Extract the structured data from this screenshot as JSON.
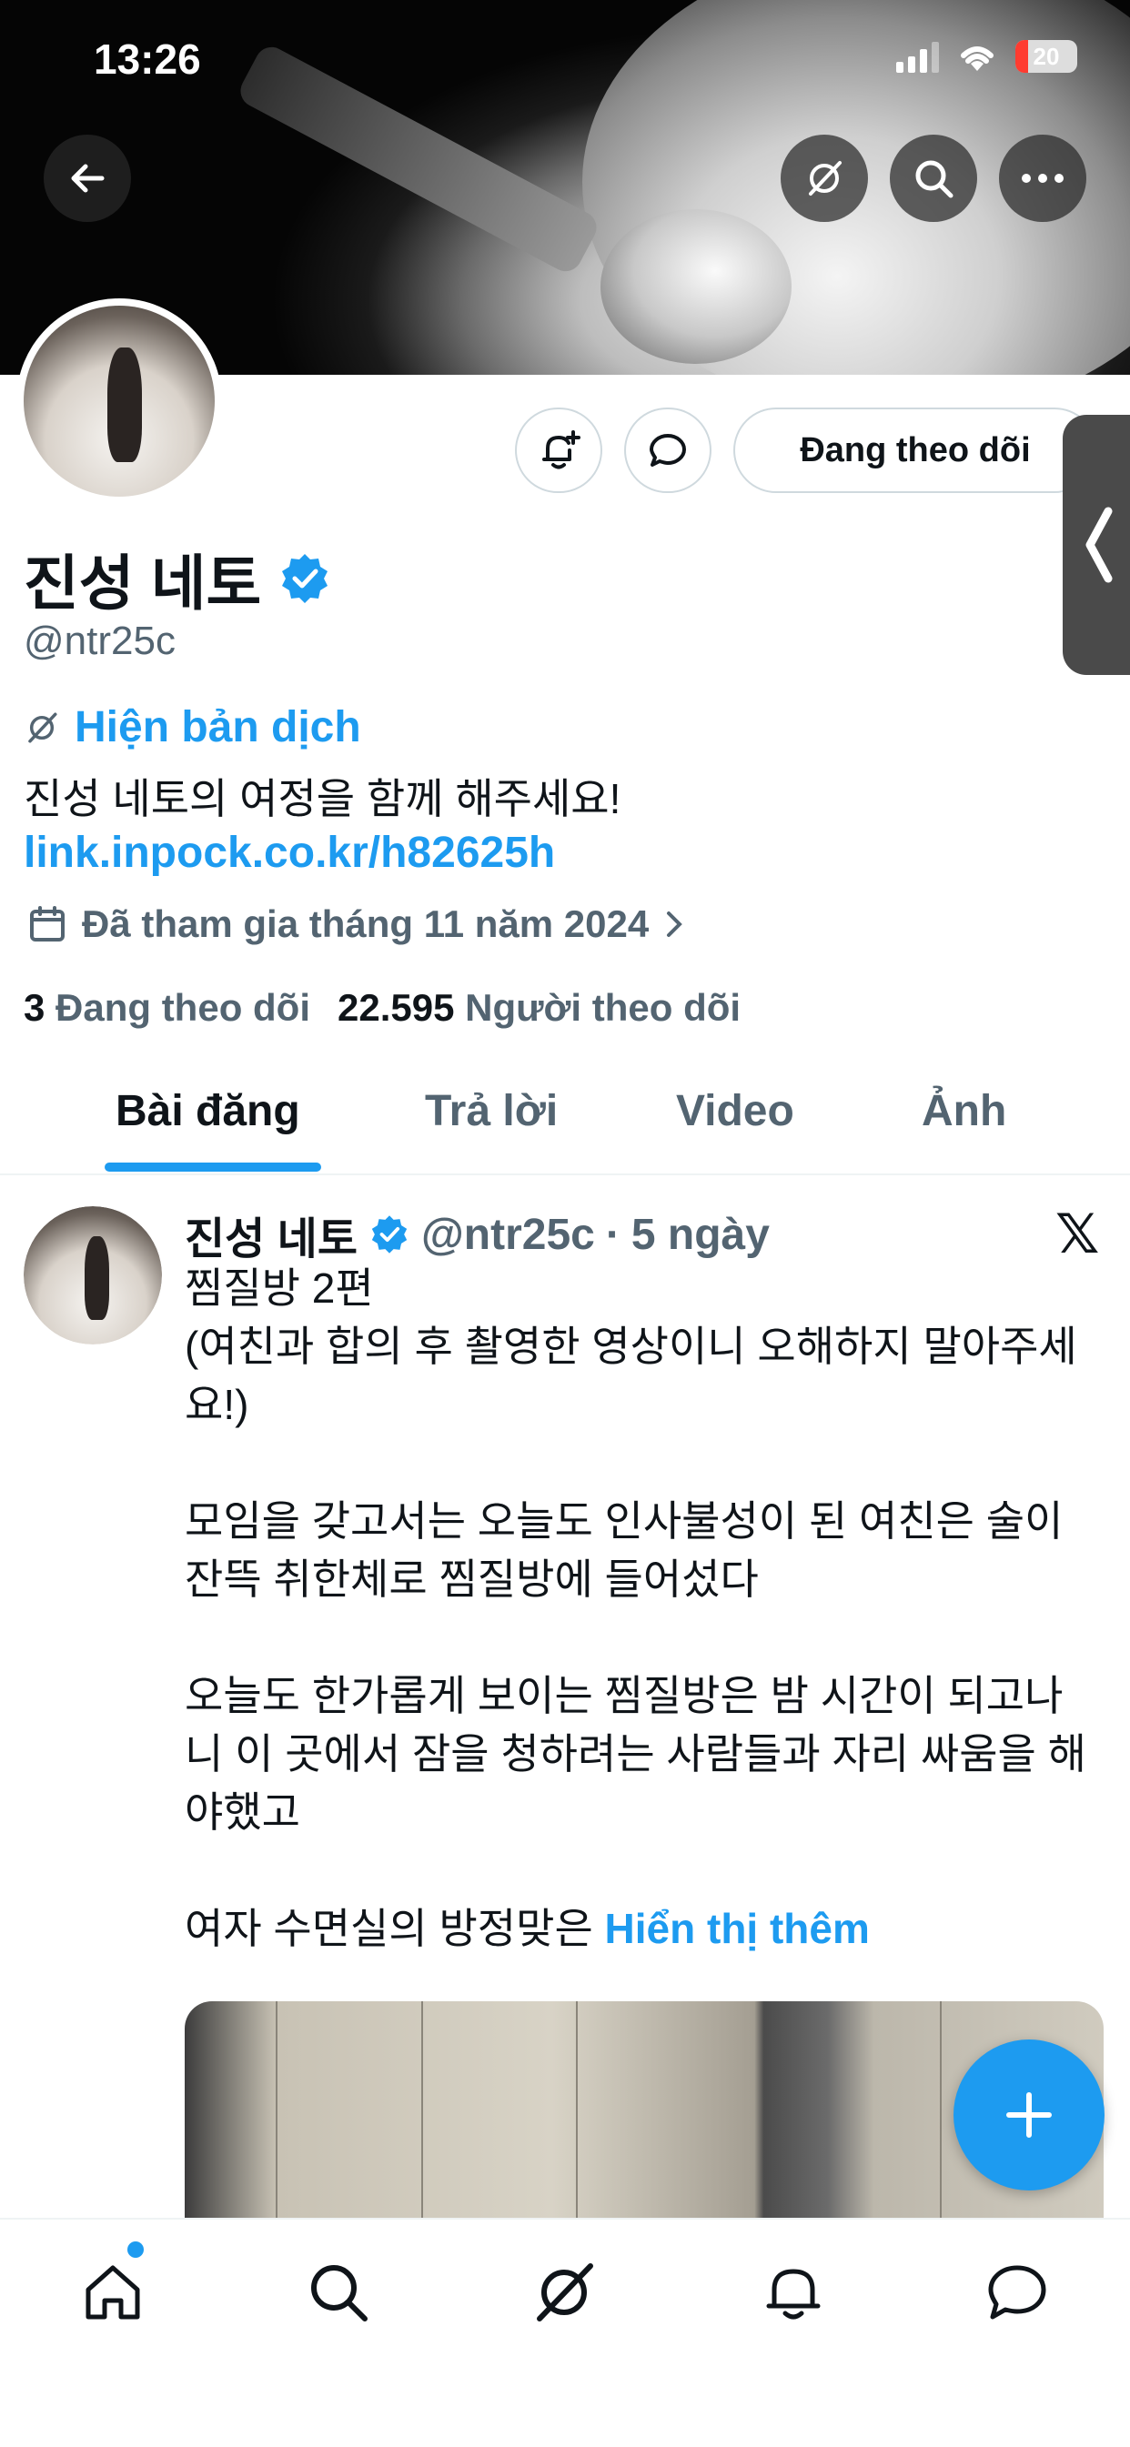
{
  "status_bar": {
    "time": "13:26",
    "battery": "20",
    "battery_level": 0.2
  },
  "profile": {
    "display_name": "진성 네토",
    "handle": "@ntr25c",
    "translate_label": "Hiện bản dịch",
    "bio": "진성 네토의 여정을 함께 해주세요!",
    "link": "link.inpock.co.kr/h82625h",
    "joined": "Đã tham gia tháng 11 năm 2024",
    "following_count": "3",
    "following_label": "Đang theo dõi",
    "followers_count": "22.595",
    "followers_label": "Người theo dõi",
    "follow_button": "Đang theo dõi"
  },
  "tabs": [
    {
      "label": "Bài đăng",
      "active": true
    },
    {
      "label": "Trả lời",
      "active": false
    },
    {
      "label": "Video",
      "active": false
    },
    {
      "label": "Ảnh",
      "active": false
    }
  ],
  "post": {
    "author_name": "진성 네토",
    "author_handle": "@ntr25c",
    "separator": "·",
    "time_ago": "5 ngày",
    "text": "찜질방 2편\n(여친과 합의 후 촬영한 영상이니 오해하지 말아주세\n요!)\n\n모임을 갖고서는 오늘도 인사불성이 된 여친은 술이\n잔뜩 취한체로 찜질방에 들어섰다\n\n오늘도 한가롭게 보이는 찜질방은 밤 시간이 되고나\n니 이 곳에서 잠을 청하려는 사람들과 자리 싸움을 해\n야했고\n\n여자 수면실의 방정맞은 ",
    "show_more": "Hiển thị thêm"
  },
  "icons": {
    "back": "back-arrow-icon",
    "grok": "grok-icon",
    "search": "search-icon",
    "more": "more-icon",
    "notify": "bell-plus-icon",
    "message": "message-icon",
    "calendar": "calendar-icon",
    "verified": "verified-badge-icon",
    "x_logo": "x-logo-icon",
    "compose": "plus-icon"
  },
  "colors": {
    "accent": "#1d9bf0",
    "muted": "#536471",
    "text": "#0f1419"
  }
}
